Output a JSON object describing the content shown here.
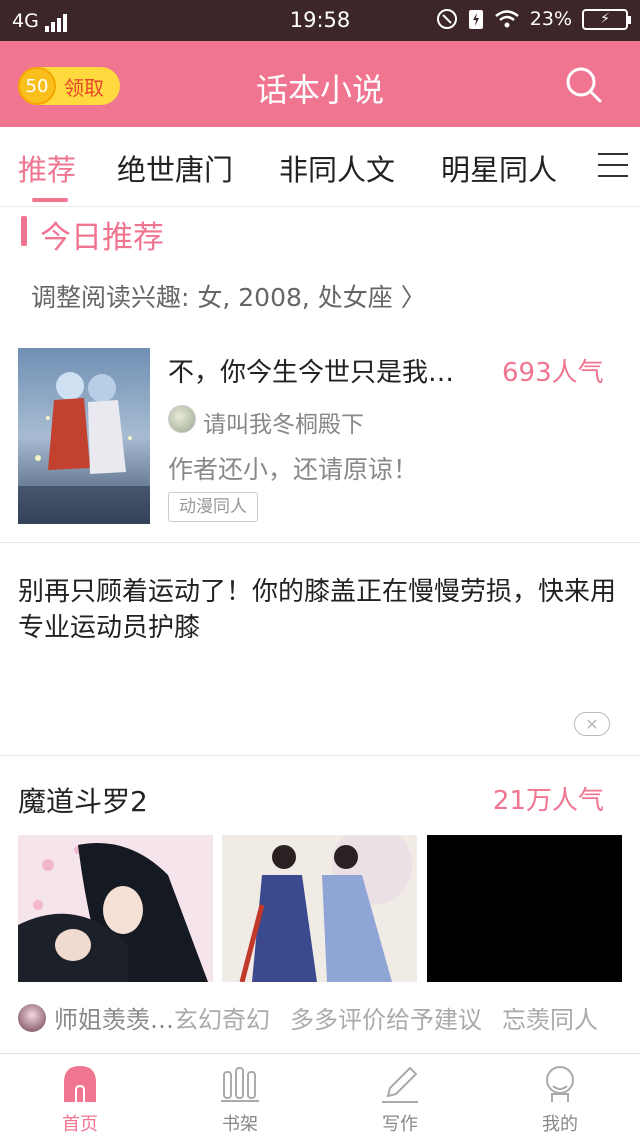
{
  "status_bar": {
    "network": "4G",
    "time": "19:58",
    "battery": "23%"
  },
  "header": {
    "coin_value": "50",
    "coin_label": "领取",
    "title": "话本小说"
  },
  "tabs": [
    {
      "label": "推荐"
    },
    {
      "label": "绝世唐门"
    },
    {
      "label": "非同人文"
    },
    {
      "label": "明星同人"
    }
  ],
  "today": {
    "title": "今日推荐",
    "interest": "调整阅读兴趣: 女, 2008, 处女座 〉"
  },
  "book": {
    "title": "不，你今生今世只是我…",
    "popularity": "693人气",
    "author": "请叫我冬桐殿下",
    "description": "作者还小，还请原谅！",
    "tag": "动漫同人"
  },
  "ad": {
    "text": "别再只顾着运动了！你的膝盖正在慢慢劳损，快来用专业运动员护膝",
    "close": "✕"
  },
  "section2": {
    "title": "魔道斗罗2",
    "popularity": "21万人气",
    "author": "师姐羡羡…",
    "tags": [
      "玄幻奇幻",
      "多多评价给予建议",
      "忘羡同人"
    ]
  },
  "bottom_nav": [
    {
      "label": "首页",
      "icon": "home-icon"
    },
    {
      "label": "书架",
      "icon": "bookshelf-icon"
    },
    {
      "label": "写作",
      "icon": "pencil-icon"
    },
    {
      "label": "我的",
      "icon": "profile-icon"
    }
  ],
  "colors": {
    "accent": "#f07590",
    "status_bar": "#3c2629",
    "coin": "#ffd93d"
  }
}
